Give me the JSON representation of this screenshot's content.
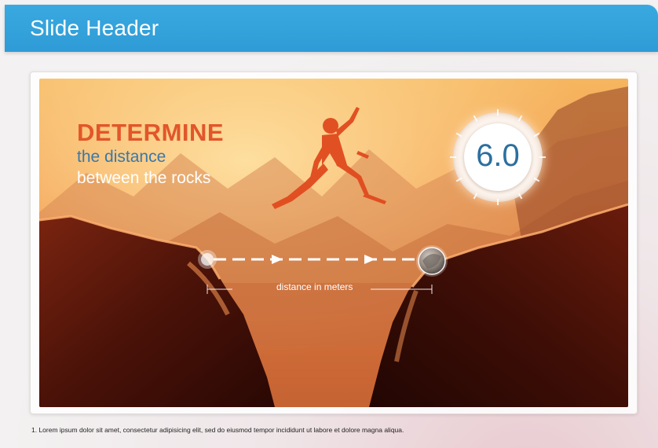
{
  "header": {
    "title": "Slide Header"
  },
  "scene": {
    "headline_strong": "DETERMINE",
    "headline_line1": "the distance",
    "headline_line2": "between the rocks",
    "gauge_value": "6.0",
    "distance_label": "distance in meters"
  },
  "footnote": {
    "text": "1. Lorem ipsum dolor sit amet, consectetur adipisicing elit, sed do eiusmod tempor incididunt ut labore et dolore magna aliqua."
  },
  "colors": {
    "header_blue": "#2e9bd6",
    "headline_orange": "#e2562a",
    "headline_blue": "#3a78a8",
    "gauge_text": "#2b6f9f"
  },
  "icons": {
    "runner": "jumping-person-silhouette",
    "start_marker": "marker-circle",
    "end_marker": "stone-marker"
  }
}
